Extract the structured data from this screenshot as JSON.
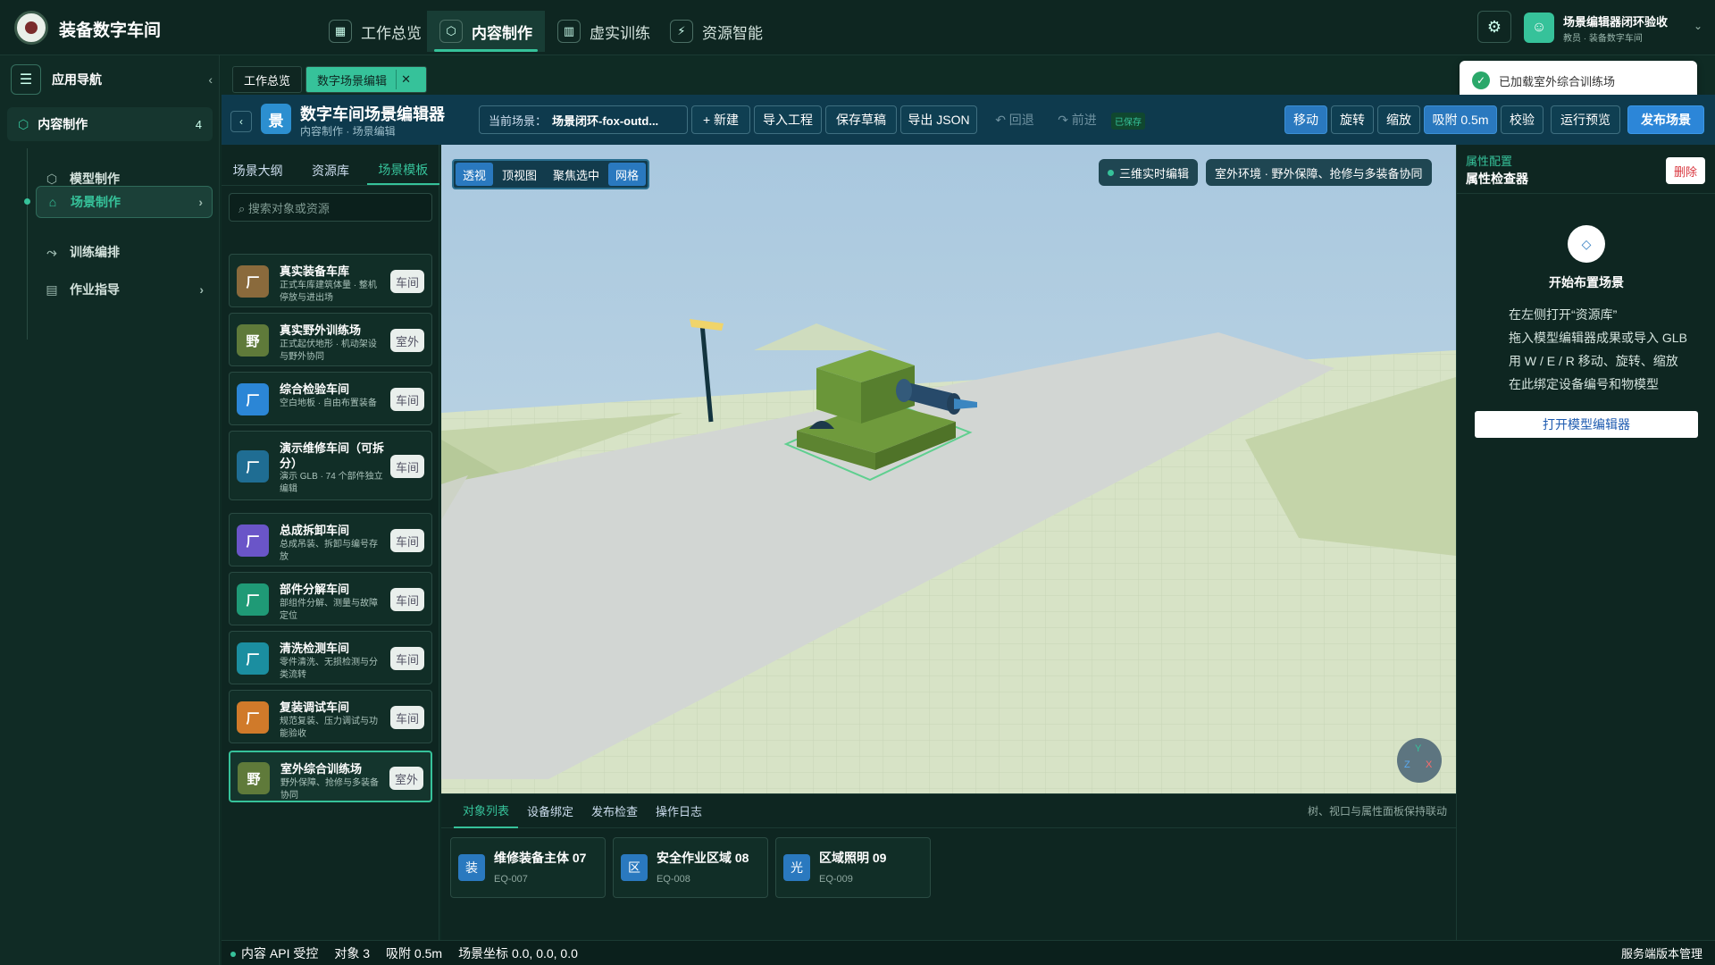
{
  "app": {
    "name": "装备数字车间"
  },
  "topnav": [
    {
      "icon": "grid-icon",
      "glyph": "▦",
      "label": "工作总览"
    },
    {
      "icon": "cube-icon",
      "glyph": "⬡",
      "label": "内容制作"
    },
    {
      "icon": "book-icon",
      "glyph": "▥",
      "label": "虚实训练"
    },
    {
      "icon": "plug-icon",
      "glyph": "⚡",
      "label": "资源智能"
    }
  ],
  "user": {
    "name": "场景编辑器闭环验收",
    "role": "教员 · 装备数字车间"
  },
  "sidebar": {
    "title": "应用导航",
    "section": {
      "label": "内容制作",
      "count": "4"
    },
    "items": [
      {
        "label": "模型制作"
      },
      {
        "label": "场景制作"
      },
      {
        "label": "训练编排"
      },
      {
        "label": "作业指导"
      }
    ]
  },
  "tabs": [
    {
      "label": "工作总览"
    },
    {
      "label": "数字场景编辑"
    }
  ],
  "toast": {
    "text": "已加载室外综合训练场"
  },
  "editor": {
    "icon": "景",
    "title": "数字车间场景编辑器",
    "breadcrumb": "内容制作 · 场景编辑",
    "scene_label": "当前场景：",
    "scene_name": "场景闭环-fox-outd...",
    "btn_new": "+ 新建",
    "btn_import": "导入工程",
    "btn_save": "保存草稿",
    "btn_export": "导出 JSON",
    "btn_undo": "↶ 回退",
    "btn_redo": "↷ 前进",
    "saved": "已保存",
    "btn_move": "移动",
    "btn_rotate": "旋转",
    "btn_scale": "缩放",
    "btn_snap": "吸附 0.5m",
    "btn_check": "校验",
    "btn_preview": "运行预览",
    "btn_publish": "发布场景"
  },
  "left_panel": {
    "tabs": [
      {
        "label": "场景大纲"
      },
      {
        "label": "资源库"
      },
      {
        "label": "场景模板"
      }
    ],
    "search_placeholder": "⌕ 搜索对象或资源",
    "cards": [
      {
        "icon": "厂",
        "color": "#8a6a3c",
        "title": "真实装备车库",
        "desc": "正式车库建筑体量 · 整机停放与进出场",
        "badge": "车间"
      },
      {
        "icon": "野",
        "color": "#5f7a3a",
        "title": "真实野外训练场",
        "desc": "正式起伏地形 · 机动架设与野外协同",
        "badge": "室外"
      },
      {
        "icon": "厂",
        "color": "#2b86d6",
        "title": "综合检验车间",
        "desc": "空白地板 · 自由布置装备",
        "badge": "车间"
      },
      {
        "icon": "厂",
        "color": "#1f6d93",
        "title": "演示维修车间（可拆分）",
        "desc": "演示 GLB · 74 个部件独立编辑",
        "badge": "车间"
      },
      {
        "icon": "厂",
        "color": "#6a55c8",
        "title": "总成拆卸车间",
        "desc": "总成吊装、拆卸与编号存放",
        "badge": "车间"
      },
      {
        "icon": "厂",
        "color": "#1f9a76",
        "title": "部件分解车间",
        "desc": "部组件分解、测量与故障定位",
        "badge": "车间"
      },
      {
        "icon": "厂",
        "color": "#1b8ea0",
        "title": "清洗检测车间",
        "desc": "零件清洗、无损检测与分类流转",
        "badge": "车间"
      },
      {
        "icon": "厂",
        "color": "#d07a2a",
        "title": "复装调试车间",
        "desc": "规范复装、压力调试与功能验收",
        "badge": "车间"
      },
      {
        "icon": "野",
        "color": "#5f7a3a",
        "title": "室外综合训练场",
        "desc": "野外保障、抢修与多装备协同",
        "badge": "室外"
      }
    ]
  },
  "viewport": {
    "modes": [
      {
        "label": "透视"
      },
      {
        "label": "顶视图"
      },
      {
        "label": "聚焦选中"
      },
      {
        "label": "网格"
      }
    ],
    "badge_3d": "三维实时编辑",
    "env": "室外环境 · 野外保障、抢修与多装备协同",
    "gizmo": {
      "y": "Y",
      "z": "Z",
      "x": "X"
    }
  },
  "tray": {
    "tabs": [
      {
        "label": "对象列表"
      },
      {
        "label": "设备绑定"
      },
      {
        "label": "发布检查"
      },
      {
        "label": "操作日志"
      }
    ],
    "note": "树、视口与属性面板保持联动",
    "objects": [
      {
        "icon": "装",
        "title": "维修装备主体 07",
        "code": "EQ-007"
      },
      {
        "icon": "区",
        "title": "安全作业区域 08",
        "code": "EQ-008"
      },
      {
        "icon": "光",
        "title": "区域照明 09",
        "code": "EQ-009"
      }
    ]
  },
  "right_panel": {
    "category": "属性配置",
    "title": "属性检查器",
    "delete": "删除",
    "empty_icon": "◇",
    "empty_title": "开始布置场景",
    "steps": [
      "在左侧打开“资源库”",
      "拖入模型编辑器成果或导入 GLB",
      "用 W / E / R 移动、旋转、缩放",
      "在此绑定设备编号和物模型"
    ],
    "open_btn": "打开模型编辑器"
  },
  "status": {
    "api": "内容 API 受控",
    "objects": "对象 3",
    "snap": "吸附 0.5m",
    "coords": "场景坐标 0.0, 0.0, 0.0",
    "version": "服务端版本管理"
  },
  "colors": {
    "accent": "#36c29a",
    "primary_blue": "#2a79bf",
    "bg": "#0f2b24"
  }
}
